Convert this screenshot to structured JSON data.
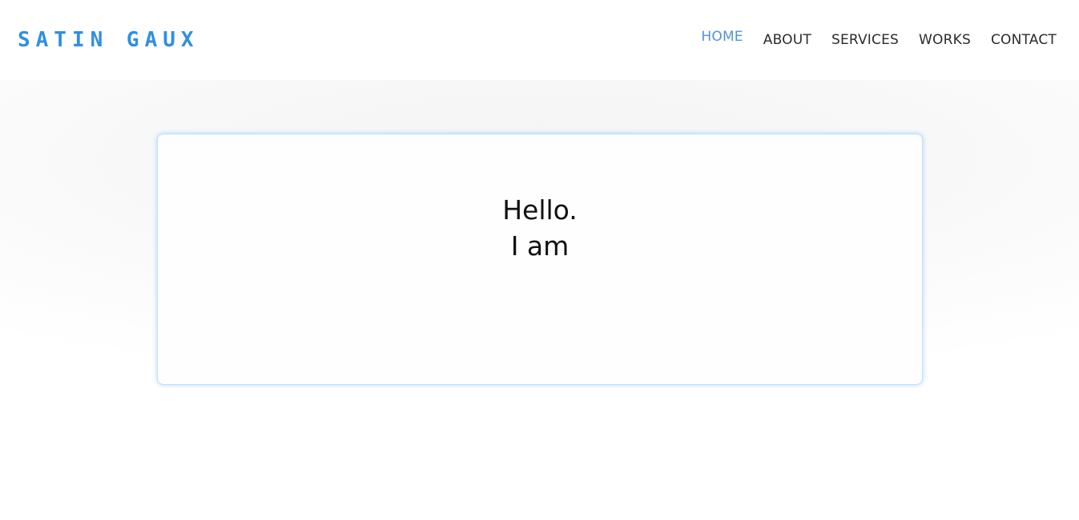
{
  "brand": {
    "logo_text": "SATIN GAUX",
    "color": "#2f8fe3"
  },
  "nav": {
    "items": [
      {
        "label": "HOME",
        "active": true
      },
      {
        "label": "ABOUT",
        "active": false
      },
      {
        "label": "SERVICES",
        "active": false
      },
      {
        "label": "WORKS",
        "active": false
      },
      {
        "label": "CONTACT",
        "active": false
      }
    ],
    "active_color": "#4f95d9",
    "text_color": "#2b2b2b"
  },
  "hero": {
    "line1": "Hello.",
    "line2": "I am"
  }
}
